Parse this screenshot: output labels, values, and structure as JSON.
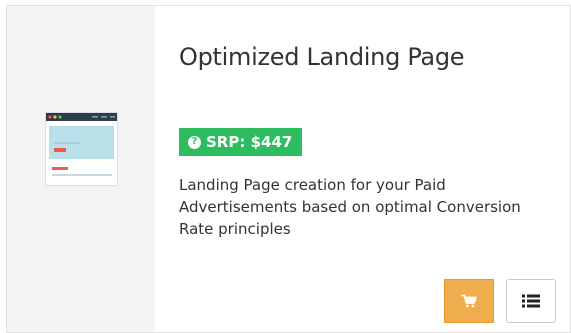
{
  "product": {
    "title": "Optimized Landing Page",
    "srp_label": "SRP: $447",
    "description": "Landing Page creation for your Paid Advertisements based on optimal Conversion Rate principles"
  },
  "icons": {
    "thumbnail": "browser-page-icon",
    "badge": "question-circle-icon",
    "cart": "shopping-cart-icon",
    "list": "list-icon"
  },
  "colors": {
    "badge": "#2dbd5f",
    "cart_button": "#f0ad4e",
    "panel": "#f4f4f4",
    "text": "#333333"
  }
}
